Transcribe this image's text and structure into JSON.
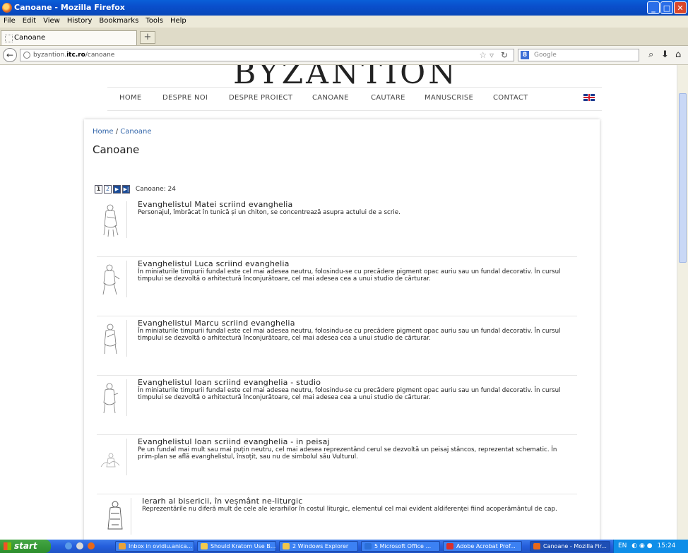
{
  "window": {
    "title": "Canoane - Mozilla Firefox",
    "controls": {
      "minimize": "_",
      "maximize": "□",
      "close": "✕"
    }
  },
  "menubar": [
    "File",
    "Edit",
    "View",
    "History",
    "Bookmarks",
    "Tools",
    "Help"
  ],
  "tab": {
    "label": "Canoane",
    "new_tab": "+"
  },
  "navbar": {
    "url_host": "byzantion.",
    "url_bold": "itc.ro",
    "url_path": "/canoane",
    "search_placeholder": "Google",
    "search_engine_letter": "8"
  },
  "site": {
    "logo": "BYZANTION",
    "nav": [
      "HOME",
      "DESPRE NOI",
      "DESPRE PROIECT",
      "CANOANE",
      "CAUTARE",
      "MANUSCRISE",
      "CONTACT"
    ]
  },
  "breadcrumb": {
    "home": "Home",
    "sep": "/",
    "current": "Canoane"
  },
  "heading": "Canoane",
  "pager": {
    "pages": [
      "1",
      "2"
    ],
    "next": "▶",
    "last": "▶|",
    "count_label": "Canoane: 24"
  },
  "items": [
    {
      "title": "Evanghelistul Matei scriind evanghelia",
      "desc": "Personajul, îmbrăcat în tunică și un chiton, se concentrează asupra actului de a scrie."
    },
    {
      "title": "Evanghelistul Luca scriind evanghelia",
      "desc": "În miniaturile timpurii fundal este cel mai adesea neutru, folosindu-se cu precădere pigment opac auriu sau un fundal decorativ. În cursul timpului se dezvoltă o arhitectură înconjurătoare, cel mai adesea cea a unui studio de cărturar."
    },
    {
      "title": "Evanghelistul Marcu scriind evanghelia",
      "desc": "În miniaturile timpurii fundal este cel mai adesea neutru, folosindu-se cu precădere pigment opac auriu sau un fundal decorativ. În cursul timpului se dezvoltă o arhitectură înconjurătoare, cel mai adesea cea a unui studio de cărturar."
    },
    {
      "title": "Evanghelistul Ioan scriind evanghelia - studio",
      "desc": "În miniaturile timpurii fundal este cel mai adesea neutru, folosindu-se cu precădere pigment opac auriu sau un fundal decorativ. În cursul timpului se dezvoltă o arhitectură înconjurătoare, cel mai adesea cea a unui studio de cărturar."
    },
    {
      "title": "Evanghelistul Ioan scriind evanghelia - in peisaj",
      "desc": "Pe un fundal mai mult sau mai puțin neutru, cel mai adesea reprezentând cerul se dezvoltă un peisaj stâncos, reprezentat schematic. În prim-plan se află evanghelistul, însoțit, sau nu de simbolul său Vulturul."
    },
    {
      "title": "Ierarh al bisericii, în veșmânt ne-liturgic",
      "desc": "Reprezentările nu diferă mult de cele ale ierarhilor în costul liturgic, elementul cel mai evident aldiferenței fiind acoperământul de cap."
    }
  ],
  "taskbar": {
    "start": "start",
    "buttons": [
      {
        "label": "Inbox in ovidiu.anica...",
        "color": "#e8a33a"
      },
      {
        "label": "Should Kratom Use B...",
        "color": "#f2c94c"
      },
      {
        "label": "2 Windows Explorer",
        "color": "#f0c64a"
      },
      {
        "label": "5 Microsoft Office ...",
        "color": "#2b6fd8"
      },
      {
        "label": "Adobe Acrobat Prof...",
        "color": "#d9302c"
      },
      {
        "label": "Canoane - Mozilla Fir...",
        "color": "#e8681a"
      }
    ],
    "lang": "EN",
    "clock": "15:24"
  },
  "colors": {
    "link": "#3366aa",
    "titlebar": "#0a4fcc",
    "taskbar": "#245edc"
  }
}
